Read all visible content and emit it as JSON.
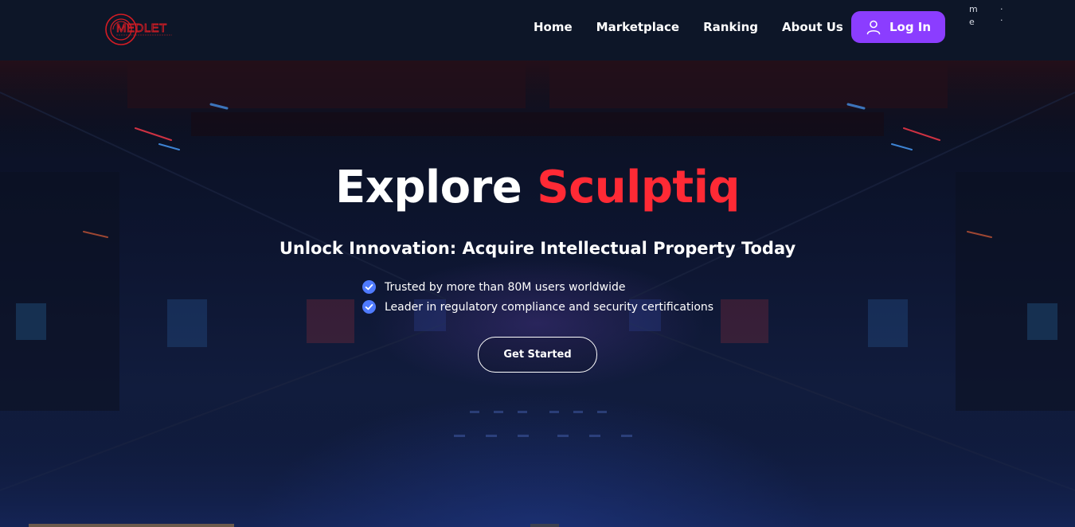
{
  "header": {
    "logo_text": "MEDLET",
    "nav": [
      {
        "label": "Home"
      },
      {
        "label": "Marketplace"
      },
      {
        "label": "Ranking"
      },
      {
        "label": "About Us"
      }
    ],
    "login_label": "Log In",
    "menu_fragment": {
      "a": "m",
      "b": "e",
      "c": "·",
      "d": "·"
    }
  },
  "hero": {
    "title_part1": "Explore",
    "title_part2": "Sculptiq",
    "subtitle": "Unlock Innovation: Acquire Intellectual Property Today",
    "features": [
      {
        "text": "Trusted by more than 80M users worldwide"
      },
      {
        "text": "Leader in regulatory compliance and security certifications"
      }
    ],
    "cta_label": "Get Started"
  },
  "colors": {
    "accent_purple": "#8b3dff",
    "title_red": "#ff2a35",
    "check_blue": "#4f7bff",
    "header_bg": "#0d1628"
  }
}
